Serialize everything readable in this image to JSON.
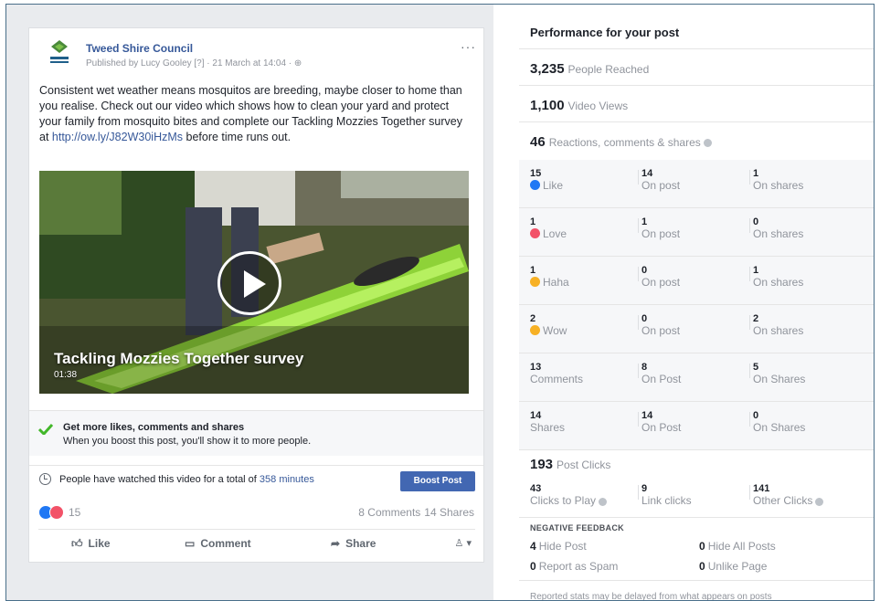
{
  "post": {
    "page_name": "Tweed Shire Council",
    "published": "Published by Lucy Gooley [?] · 21 March at 14:04 · ",
    "more": "···",
    "body_text": "Consistent wet weather means mosquitos are breeding, maybe closer to home than you realise. Check out our video which shows how to clean your yard and protect your family from mosquito bites and complete our Tackling Mozzies Together survey at ",
    "body_link": "http://ow.ly/J82W30iHzMs",
    "body_end": " before time runs out.",
    "video_title": "Tackling Mozzies Together survey",
    "video_duration": "01:38",
    "boost_tip_title": "Get more likes, comments and shares",
    "boost_tip_sub": "When you boost this post, you'll show it to more people.",
    "watch_prefix": "People have watched this video for a total of ",
    "watch_minutes": "358 minutes",
    "boost_button": "Boost Post",
    "reaction_count": "15",
    "comments": "8 Comments",
    "shares": "14 Shares",
    "actions": {
      "like": "Like",
      "comment": "Comment",
      "share": "Share"
    },
    "colors": {
      "link": "#365899",
      "boost": "#4267b2",
      "like": "#2078f4",
      "love": "#f25268"
    }
  },
  "performance": {
    "title": "Performance for your post",
    "reached": {
      "value": "3,235",
      "label": "People Reached"
    },
    "views": {
      "value": "1,100",
      "label": "Video Views"
    },
    "engagement": {
      "value": "46",
      "label": "Reactions, comments & shares"
    },
    "rows": [
      {
        "label": "Like",
        "total": "15",
        "on_post": "14",
        "on_post_label": "On post",
        "on_shares": "1",
        "on_shares_label": "On shares",
        "icon": "like-reaction-icon",
        "color": "#2078f4"
      },
      {
        "label": "Love",
        "total": "1",
        "on_post": "1",
        "on_post_label": "On post",
        "on_shares": "0",
        "on_shares_label": "On shares",
        "icon": "love-reaction-icon",
        "color": "#f25268"
      },
      {
        "label": "Haha",
        "total": "1",
        "on_post": "0",
        "on_post_label": "On post",
        "on_shares": "1",
        "on_shares_label": "On shares",
        "icon": "haha-reaction-icon",
        "color": "#f7b125"
      },
      {
        "label": "Wow",
        "total": "2",
        "on_post": "0",
        "on_post_label": "On post",
        "on_shares": "2",
        "on_shares_label": "On shares",
        "icon": "wow-reaction-icon",
        "color": "#f7b125"
      },
      {
        "label": "Comments",
        "total": "13",
        "on_post": "8",
        "on_post_label": "On Post",
        "on_shares": "5",
        "on_shares_label": "On Shares"
      },
      {
        "label": "Shares",
        "total": "14",
        "on_post": "14",
        "on_post_label": "On Post",
        "on_shares": "0",
        "on_shares_label": "On Shares"
      }
    ],
    "post_clicks": {
      "value": "193",
      "label": "Post Clicks"
    },
    "clicks": [
      {
        "value": "43",
        "label": "Clicks to Play"
      },
      {
        "value": "9",
        "label": "Link clicks"
      },
      {
        "value": "141",
        "label": "Other Clicks"
      }
    ],
    "negative_header": "NEGATIVE FEEDBACK",
    "negative": [
      {
        "value": "4",
        "label": "Hide Post"
      },
      {
        "value": "0",
        "label": "Hide All Posts"
      },
      {
        "value": "0",
        "label": "Report as Spam"
      },
      {
        "value": "0",
        "label": "Unlike Page"
      }
    ],
    "footer": "Reported stats may be delayed from what appears on posts"
  }
}
